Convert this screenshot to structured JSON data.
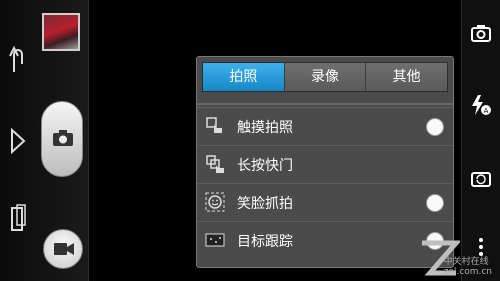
{
  "tabs": [
    {
      "label": "拍照",
      "active": true
    },
    {
      "label": "录像",
      "active": false
    },
    {
      "label": "其他",
      "active": false
    }
  ],
  "settings": [
    {
      "label": "触摸拍照",
      "icon": "touch-icon",
      "has_toggle": true
    },
    {
      "label": "长按快门",
      "icon": "long-press-icon",
      "has_toggle": false
    },
    {
      "label": "笑脸抓拍",
      "icon": "smile-icon",
      "has_toggle": true
    },
    {
      "label": "目标跟踪",
      "icon": "target-icon",
      "has_toggle": true
    }
  ],
  "icons": {
    "left": [
      "undo-arrow-icon",
      "right-chevron-icon",
      "gallery-icon"
    ],
    "right": [
      "camera-icon",
      "flash-auto-icon",
      "switch-camera-icon",
      "more-icon"
    ]
  },
  "watermark": "中关村在线",
  "watermark_domain": "zol.com.cn",
  "colors": {
    "accent": "#2a9ee0",
    "panel": "#4b4b4b"
  }
}
